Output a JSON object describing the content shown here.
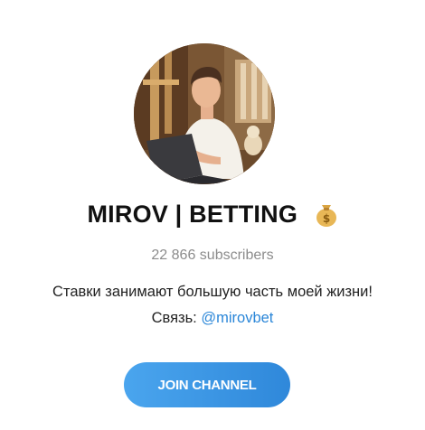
{
  "channel": {
    "name": "MIROV | BETTING",
    "badge_icon": "money-bag-icon",
    "subscribers": "22 866 subscribers",
    "description": "Ставки занимают большую часть моей жизни!",
    "contact_prefix": "Связь: ",
    "contact_handle": "@mirovbet",
    "avatar": "channel-avatar-photo"
  },
  "actions": {
    "join_label": "JOIN CHANNEL"
  },
  "colors": {
    "accent": "#2f88da",
    "link": "#2a86d8",
    "muted": "#8c8c8c"
  }
}
